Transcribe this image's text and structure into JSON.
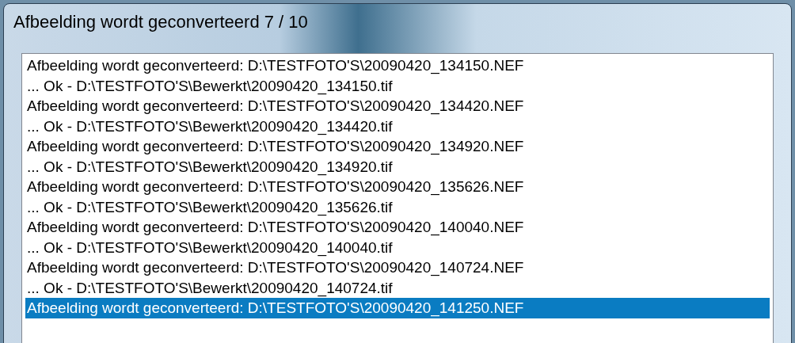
{
  "window": {
    "title": "Afbeelding wordt geconverteerd 7 / 10"
  },
  "log": {
    "lines": [
      {
        "text": "Afbeelding wordt geconverteerd: D:\\TESTFOTO'S\\20090420_134150.NEF",
        "selected": false
      },
      {
        "text": "... Ok - D:\\TESTFOTO'S\\Bewerkt\\20090420_134150.tif",
        "selected": false
      },
      {
        "text": "Afbeelding wordt geconverteerd: D:\\TESTFOTO'S\\20090420_134420.NEF",
        "selected": false
      },
      {
        "text": "... Ok - D:\\TESTFOTO'S\\Bewerkt\\20090420_134420.tif",
        "selected": false
      },
      {
        "text": "Afbeelding wordt geconverteerd: D:\\TESTFOTO'S\\20090420_134920.NEF",
        "selected": false
      },
      {
        "text": "... Ok - D:\\TESTFOTO'S\\Bewerkt\\20090420_134920.tif",
        "selected": false
      },
      {
        "text": "Afbeelding wordt geconverteerd: D:\\TESTFOTO'S\\20090420_135626.NEF",
        "selected": false
      },
      {
        "text": "... Ok - D:\\TESTFOTO'S\\Bewerkt\\20090420_135626.tif",
        "selected": false
      },
      {
        "text": "Afbeelding wordt geconverteerd: D:\\TESTFOTO'S\\20090420_140040.NEF",
        "selected": false
      },
      {
        "text": "... Ok - D:\\TESTFOTO'S\\Bewerkt\\20090420_140040.tif",
        "selected": false
      },
      {
        "text": "Afbeelding wordt geconverteerd: D:\\TESTFOTO'S\\20090420_140724.NEF",
        "selected": false
      },
      {
        "text": "... Ok - D:\\TESTFOTO'S\\Bewerkt\\20090420_140724.tif",
        "selected": false
      },
      {
        "text": "Afbeelding wordt geconverteerd: D:\\TESTFOTO'S\\20090420_141250.NEF",
        "selected": true
      }
    ]
  }
}
